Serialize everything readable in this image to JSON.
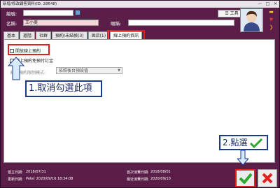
{
  "window": {
    "title": "新增/修改顧客資料(ID: 28648)",
    "controls": [
      "—",
      "□",
      "✕"
    ]
  },
  "form": {
    "id_label": "編號:",
    "id_value": "",
    "name_label": "名稱:",
    "name_value": "王小美",
    "nickname_label": "暱稱:",
    "nickname_value": "",
    "tool_button": "工具"
  },
  "tabs": [
    "基本",
    "進階",
    "社群",
    "預約/未結帳(3)",
    "固店(1)",
    "線上預約資訊"
  ],
  "panel": {
    "checkbox1_label": "開放線上預約",
    "checkbox2_label": "線上預約免預付訂金",
    "select_label": "線上預約限制模式:",
    "select_value": "依照後台預設值"
  },
  "callouts": {
    "step1": "1.取消勾選此項",
    "step2": "2.點選"
  },
  "footer": {
    "created_label": "建立日期:",
    "created_value": "2018/07/31",
    "modified_label": "更新日期:",
    "modified_value": "Peter 2020/09/16 18:34:08",
    "first_visit_label": "首次消費日期:",
    "first_visit_value": "2018/08/01",
    "last_visit_label": "最近消費日期:",
    "last_visit_value": "2020/09/10"
  },
  "colors": {
    "window_bg": "#5a1e48",
    "highlight": "#e02020",
    "callout_border": "#1c3a8e",
    "ok_green": "#2ea82e"
  }
}
